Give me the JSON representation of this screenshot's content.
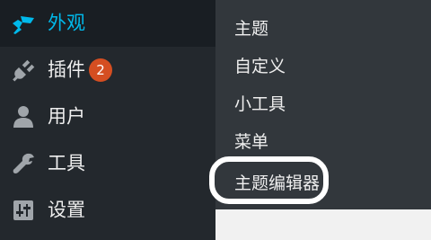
{
  "sidebar": {
    "items": [
      {
        "label": "外观",
        "icon": "appearance-brush-icon",
        "active": true
      },
      {
        "label": "插件",
        "icon": "plugins-plug-icon",
        "badge": "2"
      },
      {
        "label": "用户",
        "icon": "users-person-icon"
      },
      {
        "label": "工具",
        "icon": "tools-wrench-icon"
      },
      {
        "label": "设置",
        "icon": "settings-sliders-icon"
      }
    ]
  },
  "submenu": {
    "items": [
      {
        "label": "主题"
      },
      {
        "label": "自定义"
      },
      {
        "label": "小工具"
      },
      {
        "label": "菜单"
      },
      {
        "label": "主题编辑器",
        "highlighted": true
      }
    ]
  },
  "colors": {
    "sidebar_bg": "#23282d",
    "active_bg": "#191e23",
    "active_text": "#00b9eb",
    "submenu_bg": "#32373c",
    "badge_bg": "#d54e21",
    "text": "#eeeeee",
    "highlight_ring": "#ffffff"
  }
}
